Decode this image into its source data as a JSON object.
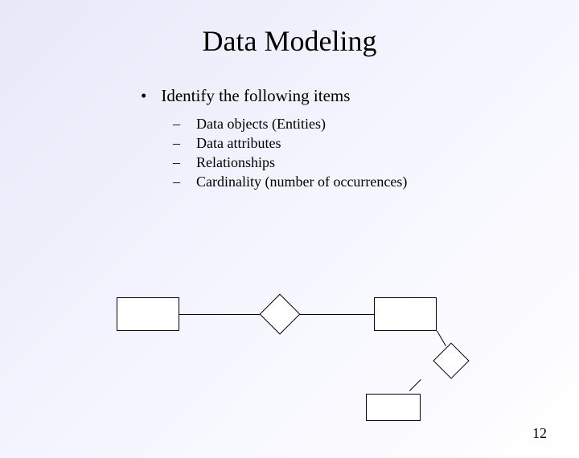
{
  "title": "Data Modeling",
  "main_bullet": "Identify the following items",
  "sub_items": [
    "Data objects (Entities)",
    "Data attributes",
    "Relationships",
    "Cardinality (number of occurrences)"
  ],
  "page_number": "12"
}
